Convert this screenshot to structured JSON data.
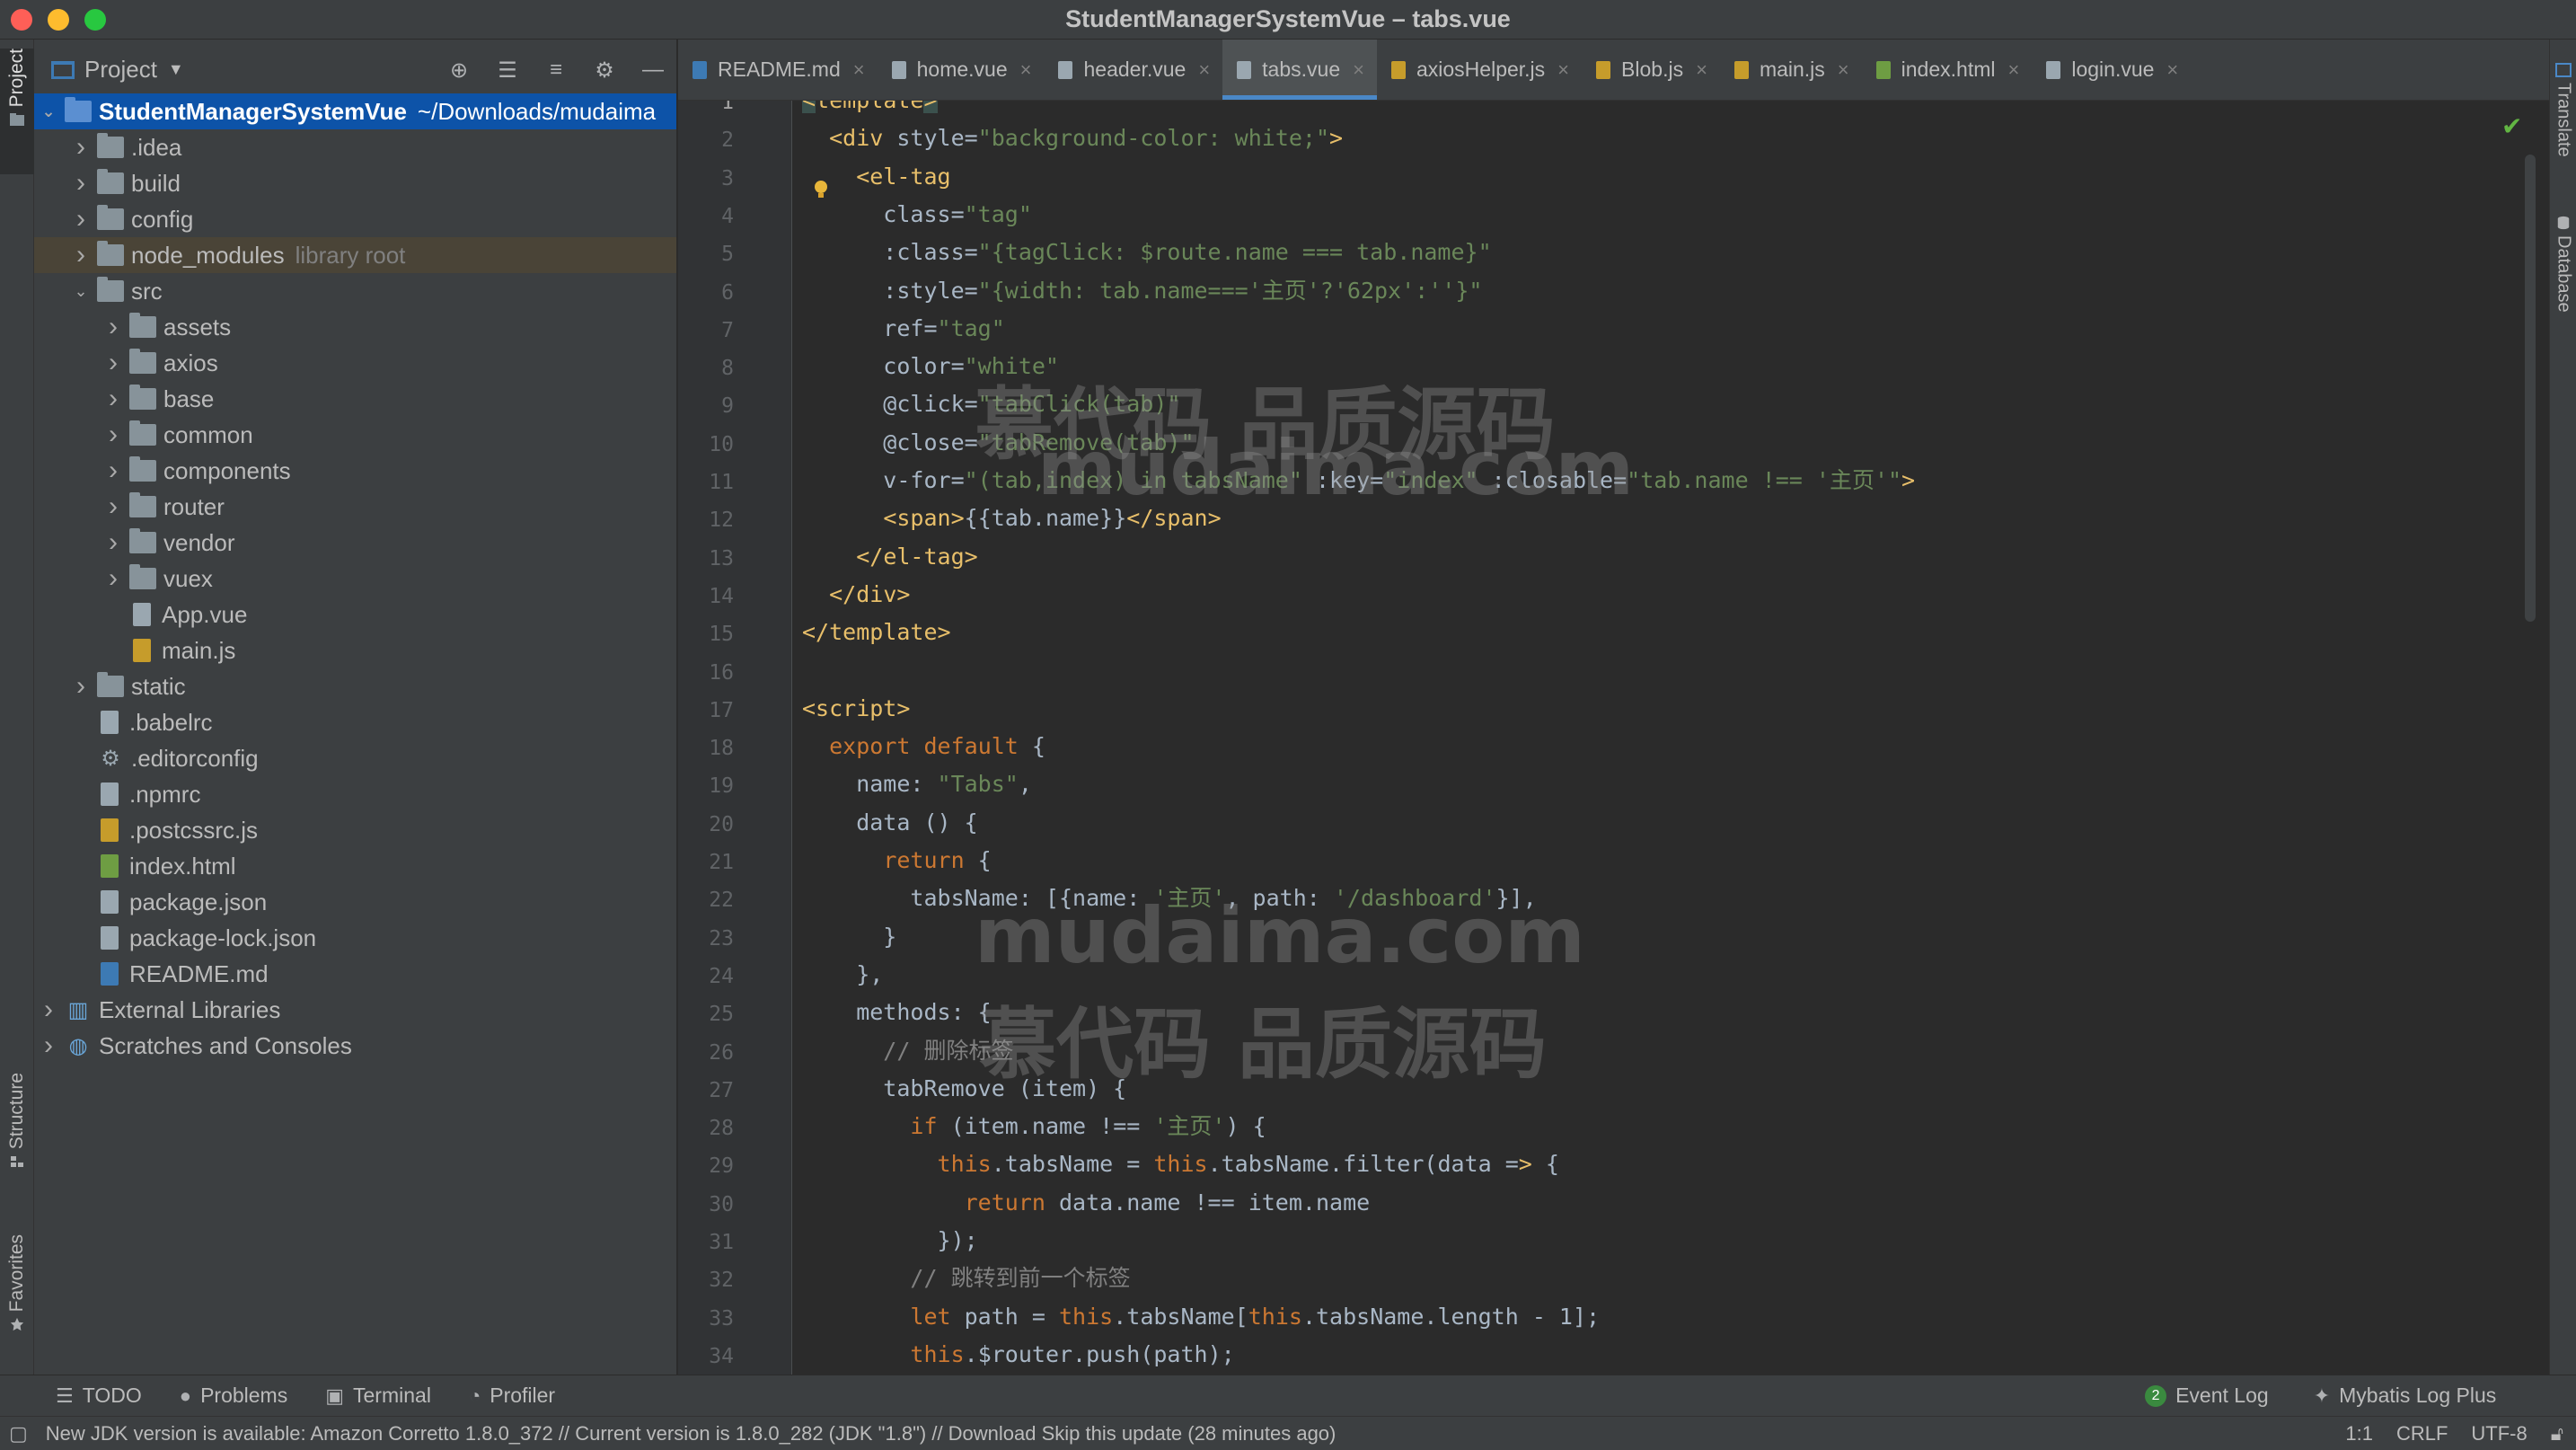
{
  "window": {
    "title": "StudentManagerSystemVue – tabs.vue"
  },
  "left_strip": {
    "project": "Project",
    "structure": "Structure",
    "favorites": "Favorites"
  },
  "right_strip": {
    "translate": "Translate",
    "database": "Database"
  },
  "project_panel": {
    "title": "Project",
    "tree": [
      {
        "label": "StudentManagerSystemVue",
        "extra": "~/Downloads/mudaima",
        "depth": 0,
        "kind": "folder-blue",
        "arrow": "down",
        "selected": true
      },
      {
        "label": ".idea",
        "depth": 1,
        "kind": "folder",
        "arrow": "right"
      },
      {
        "label": "build",
        "depth": 1,
        "kind": "folder",
        "arrow": "right"
      },
      {
        "label": "config",
        "depth": 1,
        "kind": "folder",
        "arrow": "right"
      },
      {
        "label": "node_modules",
        "extra": "library root",
        "depth": 1,
        "kind": "folder",
        "arrow": "right",
        "highlight": true
      },
      {
        "label": "src",
        "depth": 1,
        "kind": "folder",
        "arrow": "down"
      },
      {
        "label": "assets",
        "depth": 2,
        "kind": "folder",
        "arrow": "right"
      },
      {
        "label": "axios",
        "depth": 2,
        "kind": "folder",
        "arrow": "right"
      },
      {
        "label": "base",
        "depth": 2,
        "kind": "folder",
        "arrow": "right"
      },
      {
        "label": "common",
        "depth": 2,
        "kind": "folder",
        "arrow": "right"
      },
      {
        "label": "components",
        "depth": 2,
        "kind": "folder",
        "arrow": "right"
      },
      {
        "label": "router",
        "depth": 2,
        "kind": "folder",
        "arrow": "right"
      },
      {
        "label": "vendor",
        "depth": 2,
        "kind": "folder",
        "arrow": "right"
      },
      {
        "label": "vuex",
        "depth": 2,
        "kind": "folder",
        "arrow": "right"
      },
      {
        "label": "App.vue",
        "depth": 2,
        "kind": "file",
        "arrow": ""
      },
      {
        "label": "main.js",
        "depth": 2,
        "kind": "file-js",
        "arrow": ""
      },
      {
        "label": "static",
        "depth": 1,
        "kind": "folder",
        "arrow": "right"
      },
      {
        "label": ".babelrc",
        "depth": 1,
        "kind": "file-cfg",
        "arrow": ""
      },
      {
        "label": ".editorconfig",
        "depth": 1,
        "kind": "gear",
        "arrow": ""
      },
      {
        "label": ".npmrc",
        "depth": 1,
        "kind": "file",
        "arrow": ""
      },
      {
        "label": ".postcssrc.js",
        "depth": 1,
        "kind": "file-js",
        "arrow": ""
      },
      {
        "label": "index.html",
        "depth": 1,
        "kind": "file-html",
        "arrow": ""
      },
      {
        "label": "package.json",
        "depth": 1,
        "kind": "file-cfg",
        "arrow": ""
      },
      {
        "label": "package-lock.json",
        "depth": 1,
        "kind": "file-cfg",
        "arrow": ""
      },
      {
        "label": "README.md",
        "depth": 1,
        "kind": "file-md",
        "arrow": ""
      },
      {
        "label": "External Libraries",
        "depth": 0,
        "kind": "lib",
        "arrow": "right"
      },
      {
        "label": "Scratches and Consoles",
        "depth": 0,
        "kind": "scratch",
        "arrow": "right"
      }
    ]
  },
  "tabs": [
    {
      "label": "README.md",
      "icon": "md"
    },
    {
      "label": "home.vue",
      "icon": "file"
    },
    {
      "label": "header.vue",
      "icon": "file"
    },
    {
      "label": "tabs.vue",
      "icon": "file",
      "active": true
    },
    {
      "label": "axiosHelper.js",
      "icon": "js"
    },
    {
      "label": "Blob.js",
      "icon": "js"
    },
    {
      "label": "main.js",
      "icon": "js"
    },
    {
      "label": "index.html",
      "icon": "html"
    },
    {
      "label": "login.vue",
      "icon": "file"
    }
  ],
  "code_lines": [
    "<template>",
    "  <div style=\"background-color: white;\">",
    "    <el-tag",
    "      class=\"tag\"",
    "      :class=\"{tagClick: $route.name === tab.name}\"",
    "      :style=\"{width: tab.name==='主页'?'62px':''}\"",
    "      ref=\"tag\"",
    "      color=\"white\"",
    "      @click=\"tabClick(tab)\"",
    "      @close=\"tabRemove(tab)\"",
    "      v-for=\"(tab,index) in tabsName\" :key=\"index\" :closable=\"tab.name !== '主页'\">",
    "      <span>{{tab.name}}</span>",
    "    </el-tag>",
    "  </div>",
    "</template>",
    "",
    "<script>",
    "  export default {",
    "    name: \"Tabs\",",
    "    data () {",
    "      return {",
    "        tabsName: [{name: '主页', path: '/dashboard'}],",
    "      }",
    "    },",
    "    methods: {",
    "      // 删除标签",
    "      tabRemove (item) {",
    "        if (item.name !== '主页') {",
    "          this.tabsName = this.tabsName.filter(data => {",
    "            return data.name !== item.name",
    "          });",
    "        // 跳转到前一个标签",
    "        let path = this.tabsName[this.tabsName.length - 1];",
    "        this.$router.push(path);"
  ],
  "watermarks": [
    "慕代码 品质源码",
    "mudaima.com",
    "mudaima.com",
    "慕代码 品质源码"
  ],
  "bottom_tools": {
    "todo": "TODO",
    "problems": "Problems",
    "terminal": "Terminal",
    "profiler": "Profiler",
    "event_log_count": "2",
    "event_log": "Event Log",
    "mybatis": "Mybatis Log Plus"
  },
  "status": {
    "message": "New JDK version is available: Amazon Corretto 1.8.0_372 // Current version is 1.8.0_282 (JDK \"1.8\") // Download   Skip this update (28 minutes ago)",
    "position": "1:1",
    "line_sep": "CRLF",
    "encoding": "UTF-8"
  },
  "colors": {
    "accent": "#4a88c7",
    "selection": "#0d53a8",
    "tag": "#e8bf6a",
    "string": "#6a8759",
    "keyword": "#cc7832",
    "comment": "#808080"
  }
}
